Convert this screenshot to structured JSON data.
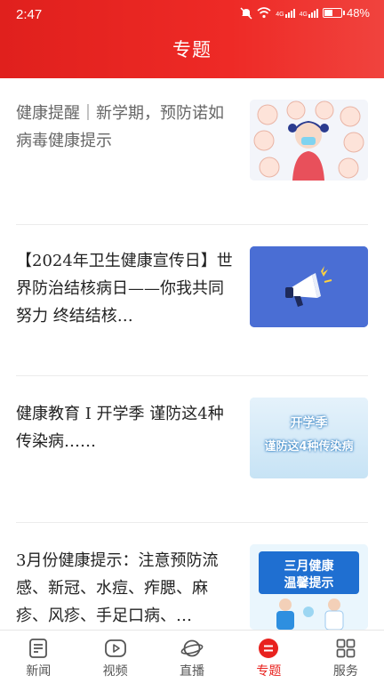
{
  "status_bar": {
    "time": "2:47",
    "battery": "48%",
    "signal_label_1": "4G",
    "signal_label_2": "4G"
  },
  "header": {
    "title": "专题"
  },
  "articles": [
    {
      "title": "健康提醒｜新学期，预防诺如病毒健康提示",
      "thumb_icon": "handwashing-illustration"
    },
    {
      "title": "【2024年卫生健康宣传日】世界防治结核病日——你我共同努力 终结结核…",
      "thumb_icon": "megaphone-illustration"
    },
    {
      "title": "健康教育 I 开学季 谨防这4种传染病……",
      "thumb_icon": "school-season-banner",
      "thumb_text_1": "开学季",
      "thumb_text_2": "谨防这4种传染病"
    },
    {
      "title": "3月份健康提示：注意预防流感、新冠、水痘、痄腮、麻疹、风疹、手足口病、…",
      "thumb_icon": "march-health-banner",
      "thumb_text_1": "三月健康",
      "thumb_text_2": "温馨提示"
    }
  ],
  "tabbar": {
    "items": [
      {
        "label": "新闻",
        "icon": "news-icon"
      },
      {
        "label": "视频",
        "icon": "video-icon"
      },
      {
        "label": "直播",
        "icon": "live-icon"
      },
      {
        "label": "专题",
        "icon": "topic-icon",
        "active": true
      },
      {
        "label": "服务",
        "icon": "service-icon"
      }
    ]
  },
  "colors": {
    "brand_red": "#e8221e",
    "text": "#222222",
    "tab_inactive": "#555555"
  }
}
